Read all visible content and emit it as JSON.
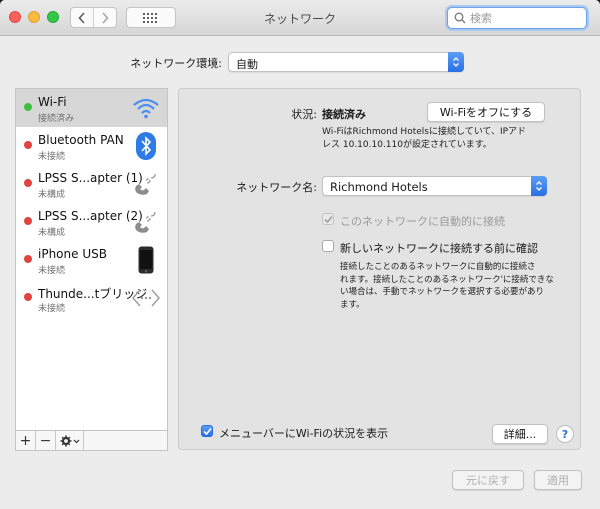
{
  "window": {
    "title": "ネットワーク"
  },
  "search": {
    "placeholder": "検索"
  },
  "location": {
    "label": "ネットワーク環境:",
    "value": "自動"
  },
  "services": [
    {
      "name": "Wi-Fi",
      "status": "接続済み",
      "dot_color": "#3fbf3f",
      "icon": "wifi-icon"
    },
    {
      "name": "Bluetooth PAN",
      "status": "未接続",
      "dot_color": "#e0443e",
      "icon": "bluetooth-icon"
    },
    {
      "name": "LPSS S...apter (1)",
      "status": "未構成",
      "dot_color": "#e0443e",
      "icon": "phone-signal-icon"
    },
    {
      "name": "LPSS S...apter (2)",
      "status": "未構成",
      "dot_color": "#e0443e",
      "icon": "phone-signal-icon"
    },
    {
      "name": "iPhone USB",
      "status": "未接続",
      "dot_color": "#e0443e",
      "icon": "iphone-icon"
    },
    {
      "name": "Thunde...tブリッジ",
      "status": "未接続",
      "dot_color": "#e0443e",
      "icon": "thunderbolt-bridge-icon"
    }
  ],
  "sidebar_footer": {
    "add": "+",
    "remove": "−"
  },
  "detail": {
    "status_label": "状況:",
    "status_value": "接続済み",
    "wifi_off_button": "Wi-Fiをオフにする",
    "status_description_line1": "Wi-FiはRichmond Hotelsに接続していて、IPアド",
    "status_description_line2": "レス 10.10.10.110が設定されています。",
    "network_name_label": "ネットワーク名:",
    "network_name_value": "Richmond Hotels",
    "auto_join_label": "このネットワークに自動的に接続",
    "auto_join_checked": true,
    "ask_join_label": "新しいネットワークに接続する前に確認",
    "ask_join_checked": false,
    "ask_join_description_line1": "接続したことのあるネットワークに自動的に接続さ",
    "ask_join_description_line2": "れます。接続したことのあるネットワーク'に接続できな",
    "ask_join_description_line3": "い場合は、手動でネットワークを選択する必要があり",
    "ask_join_description_line4": "ます。",
    "menubar_label": "メニューバーにWi-Fiの状況を表示",
    "menubar_checked": true,
    "advanced_button": "詳細...",
    "help": "?"
  },
  "footer": {
    "revert": "元に戻す",
    "apply": "適用"
  },
  "colors": {
    "accent": "#2a6fe2",
    "connected": "#3fbf3f",
    "disconnected": "#e0443e"
  }
}
